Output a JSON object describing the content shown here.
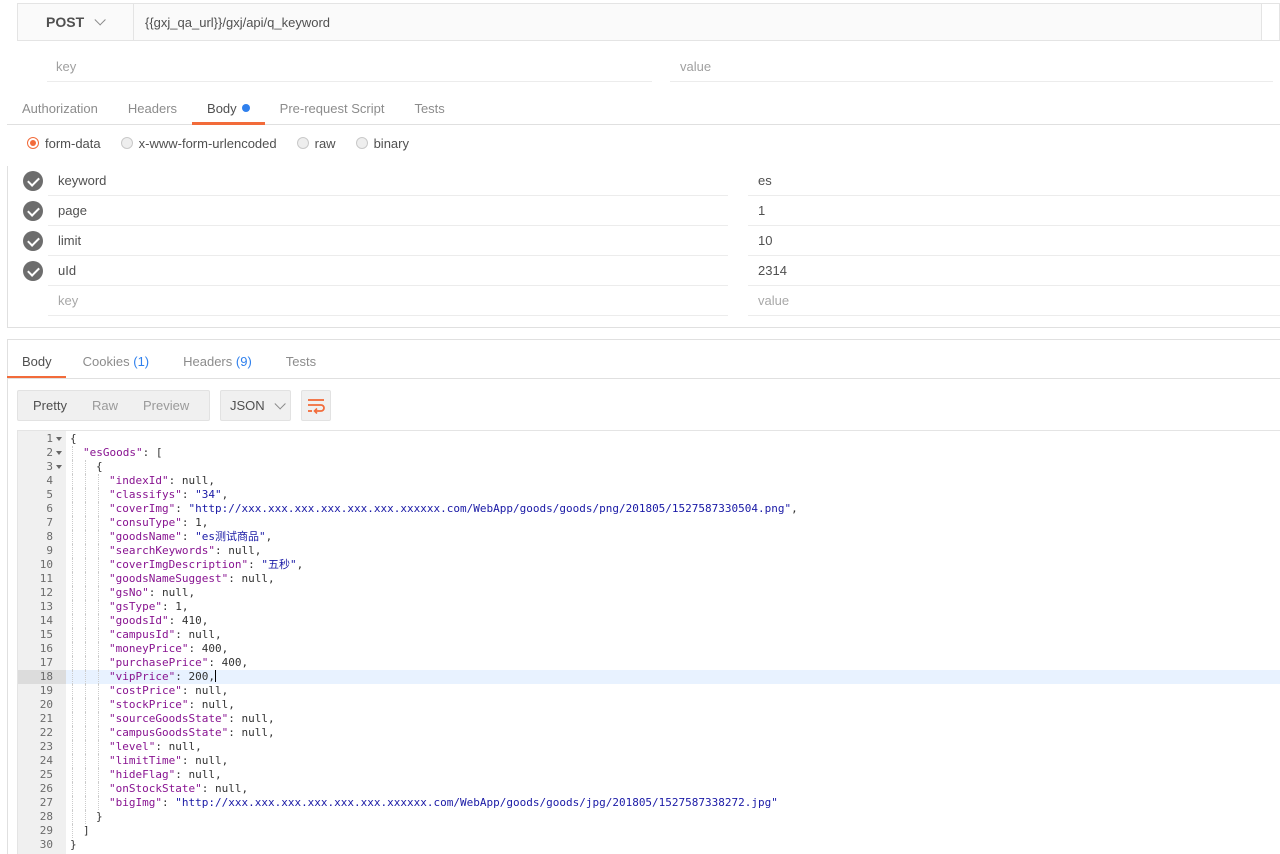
{
  "request": {
    "method": "POST",
    "url": "{{gxj_qa_url}}/gxj/api/q_keyword"
  },
  "params_placeholder": {
    "key": "key",
    "value": "value"
  },
  "request_tabs": [
    {
      "label": "Authorization"
    },
    {
      "label": "Headers"
    },
    {
      "label": "Body"
    },
    {
      "label": "Pre-request Script"
    },
    {
      "label": "Tests"
    }
  ],
  "body_types": [
    {
      "label": "form-data"
    },
    {
      "label": "x-www-form-urlencoded"
    },
    {
      "label": "raw"
    },
    {
      "label": "binary"
    }
  ],
  "form_rows": [
    {
      "key": "keyword",
      "value": "es"
    },
    {
      "key": "page",
      "value": "1"
    },
    {
      "key": "limit",
      "value": "10"
    },
    {
      "key": "uId",
      "value": "2314"
    }
  ],
  "form_placeholder": {
    "key": "key",
    "value": "value"
  },
  "response_tabs": {
    "body": "Body",
    "cookies": "Cookies",
    "cookies_count": "(1)",
    "headers": "Headers",
    "headers_count": "(9)",
    "tests": "Tests"
  },
  "view_modes": [
    {
      "label": "Pretty"
    },
    {
      "label": "Raw"
    },
    {
      "label": "Preview"
    }
  ],
  "format": "JSON",
  "highlight_line": 18,
  "code_lines": [
    {
      "ln": "1",
      "indent": 0,
      "fold": true,
      "tokens": [
        [
          "p",
          "{"
        ]
      ]
    },
    {
      "ln": "2",
      "indent": 1,
      "fold": true,
      "tokens": [
        [
          "k",
          "\"esGoods\""
        ],
        [
          "p",
          ": ["
        ]
      ]
    },
    {
      "ln": "3",
      "indent": 2,
      "fold": true,
      "tokens": [
        [
          "p",
          "{"
        ]
      ]
    },
    {
      "ln": "4",
      "indent": 3,
      "tokens": [
        [
          "k",
          "\"indexId\""
        ],
        [
          "p",
          ": null,"
        ]
      ]
    },
    {
      "ln": "5",
      "indent": 3,
      "tokens": [
        [
          "k",
          "\"classifys\""
        ],
        [
          "p",
          ": "
        ],
        [
          "s",
          "\"34\""
        ],
        [
          "p",
          ","
        ]
      ]
    },
    {
      "ln": "6",
      "indent": 3,
      "tokens": [
        [
          "k",
          "\"coverImg\""
        ],
        [
          "p",
          ": "
        ],
        [
          "s",
          "\"http://xxx.xxx.xxx.xxx.xxx.xxx.xxxxxx.com/WebApp/goods/goods/png/201805/1527587330504.png\""
        ],
        [
          "p",
          ","
        ]
      ]
    },
    {
      "ln": "7",
      "indent": 3,
      "tokens": [
        [
          "k",
          "\"consuType\""
        ],
        [
          "p",
          ": 1,"
        ]
      ]
    },
    {
      "ln": "8",
      "indent": 3,
      "tokens": [
        [
          "k",
          "\"goodsName\""
        ],
        [
          "p",
          ": "
        ],
        [
          "s",
          "\"es测试商品\""
        ],
        [
          "p",
          ","
        ]
      ]
    },
    {
      "ln": "9",
      "indent": 3,
      "tokens": [
        [
          "k",
          "\"searchKeywords\""
        ],
        [
          "p",
          ": null,"
        ]
      ]
    },
    {
      "ln": "10",
      "indent": 3,
      "tokens": [
        [
          "k",
          "\"coverImgDescription\""
        ],
        [
          "p",
          ": "
        ],
        [
          "s",
          "\"五秒\""
        ],
        [
          "p",
          ","
        ]
      ]
    },
    {
      "ln": "11",
      "indent": 3,
      "tokens": [
        [
          "k",
          "\"goodsNameSuggest\""
        ],
        [
          "p",
          ": null,"
        ]
      ]
    },
    {
      "ln": "12",
      "indent": 3,
      "tokens": [
        [
          "k",
          "\"gsNo\""
        ],
        [
          "p",
          ": null,"
        ]
      ]
    },
    {
      "ln": "13",
      "indent": 3,
      "tokens": [
        [
          "k",
          "\"gsType\""
        ],
        [
          "p",
          ": 1,"
        ]
      ]
    },
    {
      "ln": "14",
      "indent": 3,
      "tokens": [
        [
          "k",
          "\"goodsId\""
        ],
        [
          "p",
          ": 410,"
        ]
      ]
    },
    {
      "ln": "15",
      "indent": 3,
      "tokens": [
        [
          "k",
          "\"campusId\""
        ],
        [
          "p",
          ": null,"
        ]
      ]
    },
    {
      "ln": "16",
      "indent": 3,
      "tokens": [
        [
          "k",
          "\"moneyPrice\""
        ],
        [
          "p",
          ": 400,"
        ]
      ]
    },
    {
      "ln": "17",
      "indent": 3,
      "tokens": [
        [
          "k",
          "\"purchasePrice\""
        ],
        [
          "p",
          ": 400,"
        ]
      ]
    },
    {
      "ln": "18",
      "indent": 3,
      "tokens": [
        [
          "k",
          "\"vipPrice\""
        ],
        [
          "p",
          ": 200,"
        ]
      ]
    },
    {
      "ln": "19",
      "indent": 3,
      "tokens": [
        [
          "k",
          "\"costPrice\""
        ],
        [
          "p",
          ": null,"
        ]
      ]
    },
    {
      "ln": "20",
      "indent": 3,
      "tokens": [
        [
          "k",
          "\"stockPrice\""
        ],
        [
          "p",
          ": null,"
        ]
      ]
    },
    {
      "ln": "21",
      "indent": 3,
      "tokens": [
        [
          "k",
          "\"sourceGoodsState\""
        ],
        [
          "p",
          ": null,"
        ]
      ]
    },
    {
      "ln": "22",
      "indent": 3,
      "tokens": [
        [
          "k",
          "\"campusGoodsState\""
        ],
        [
          "p",
          ": null,"
        ]
      ]
    },
    {
      "ln": "23",
      "indent": 3,
      "tokens": [
        [
          "k",
          "\"level\""
        ],
        [
          "p",
          ": null,"
        ]
      ]
    },
    {
      "ln": "24",
      "indent": 3,
      "tokens": [
        [
          "k",
          "\"limitTime\""
        ],
        [
          "p",
          ": null,"
        ]
      ]
    },
    {
      "ln": "25",
      "indent": 3,
      "tokens": [
        [
          "k",
          "\"hideFlag\""
        ],
        [
          "p",
          ": null,"
        ]
      ]
    },
    {
      "ln": "26",
      "indent": 3,
      "tokens": [
        [
          "k",
          "\"onStockState\""
        ],
        [
          "p",
          ": null,"
        ]
      ]
    },
    {
      "ln": "27",
      "indent": 3,
      "tokens": [
        [
          "k",
          "\"bigImg\""
        ],
        [
          "p",
          ": "
        ],
        [
          "s",
          "\"http://xxx.xxx.xxx.xxx.xxx.xxx.xxxxxx.com/WebApp/goods/goods/jpg/201805/1527587338272.jpg\""
        ]
      ]
    },
    {
      "ln": "28",
      "indent": 2,
      "tokens": [
        [
          "p",
          "}"
        ]
      ]
    },
    {
      "ln": "29",
      "indent": 1,
      "tokens": [
        [
          "p",
          "]"
        ]
      ]
    },
    {
      "ln": "30",
      "indent": 0,
      "tokens": [
        [
          "p",
          "}"
        ]
      ]
    }
  ]
}
